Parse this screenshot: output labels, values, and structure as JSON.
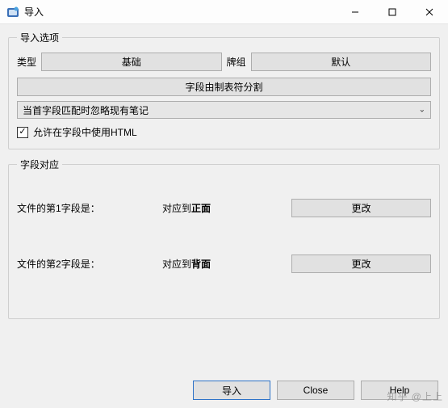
{
  "window": {
    "title": "导入"
  },
  "options": {
    "legend": "导入选项",
    "type_label": "类型",
    "type_button": "基础",
    "deck_label": "牌组",
    "deck_button": "默认",
    "tab_split_button": "字段由制表符分割",
    "select_value": "当首字段匹配时忽略现有笔记",
    "allow_html_label": "允许在字段中使用HTML",
    "allow_html_checked": true
  },
  "mapping": {
    "legend": "字段对应",
    "rows": [
      {
        "left_prefix": "文件的第",
        "left_num": "1",
        "left_suffix": "字段是：",
        "mid_prefix": "对应到",
        "mid_bold": "正面",
        "change": "更改"
      },
      {
        "left_prefix": "文件的第",
        "left_num": "2",
        "left_suffix": "字段是：",
        "mid_prefix": "对应到",
        "mid_bold": "背面",
        "change": "更改"
      }
    ]
  },
  "footer": {
    "import": "导入",
    "close": "Close",
    "help": "Help"
  },
  "watermark": "知乎 @上上"
}
